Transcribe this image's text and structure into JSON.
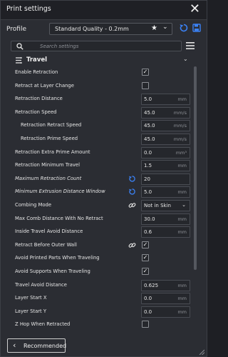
{
  "window": {
    "title": "Print settings"
  },
  "profile": {
    "label": "Profile",
    "selected": "Standard Quality - 0.2mm"
  },
  "search": {
    "placeholder": "Search settings"
  },
  "section": {
    "title": "Travel"
  },
  "settings": [
    {
      "label": "Enable Retraction",
      "type": "checkbox",
      "checked": true
    },
    {
      "label": "Retract at Layer Change",
      "type": "checkbox",
      "checked": false
    },
    {
      "label": "Retraction Distance",
      "type": "number",
      "value": "5.0",
      "unit": "mm"
    },
    {
      "label": "Retraction Speed",
      "type": "number",
      "value": "45.0",
      "unit": "mm/s"
    },
    {
      "label": "Retraction Retract Speed",
      "type": "number",
      "value": "45.0",
      "unit": "mm/s",
      "sub": true
    },
    {
      "label": "Retraction Prime Speed",
      "type": "number",
      "value": "45.0",
      "unit": "mm/s",
      "sub": true
    },
    {
      "label": "Retraction Extra Prime Amount",
      "type": "number",
      "value": "0.0",
      "unit": "mm³"
    },
    {
      "label": "Retraction Minimum Travel",
      "type": "number",
      "value": "1.5",
      "unit": "mm"
    },
    {
      "label": "Maximum Retraction Count",
      "type": "number",
      "value": "20",
      "unit": "",
      "italic": true,
      "icon": "reset-icon"
    },
    {
      "label": "Minimum Extrusion Distance Window",
      "type": "number",
      "value": "5.0",
      "unit": "mm",
      "italic": true,
      "icon": "reset-icon"
    },
    {
      "label": "Combing Mode",
      "type": "select",
      "value": "Not in Skin",
      "icon": "link-icon"
    },
    {
      "label": "Max Comb Distance With No Retract",
      "type": "number",
      "value": "30.0",
      "unit": "mm"
    },
    {
      "label": "Inside Travel Avoid Distance",
      "type": "number",
      "value": "0.6",
      "unit": "mm"
    },
    {
      "label": "Retract Before Outer Wall",
      "type": "checkbox",
      "checked": true,
      "icon": "link-icon"
    },
    {
      "label": "Avoid Printed Parts When Traveling",
      "type": "checkbox",
      "checked": true
    },
    {
      "label": "Avoid Supports When Traveling",
      "type": "checkbox",
      "checked": true
    },
    {
      "label": "Travel Avoid Distance",
      "type": "number",
      "value": "0.625",
      "unit": "mm"
    },
    {
      "label": "Layer Start X",
      "type": "number",
      "value": "0.0",
      "unit": "mm"
    },
    {
      "label": "Layer Start Y",
      "type": "number",
      "value": "0.0",
      "unit": "mm"
    },
    {
      "label": "Z Hop When Retracted",
      "type": "checkbox",
      "checked": false
    }
  ],
  "footer": {
    "recommended_label": "Recommended"
  },
  "colors": {
    "accent": "#3b82f6",
    "panel": "#2b2d33",
    "field": "#25272c"
  }
}
